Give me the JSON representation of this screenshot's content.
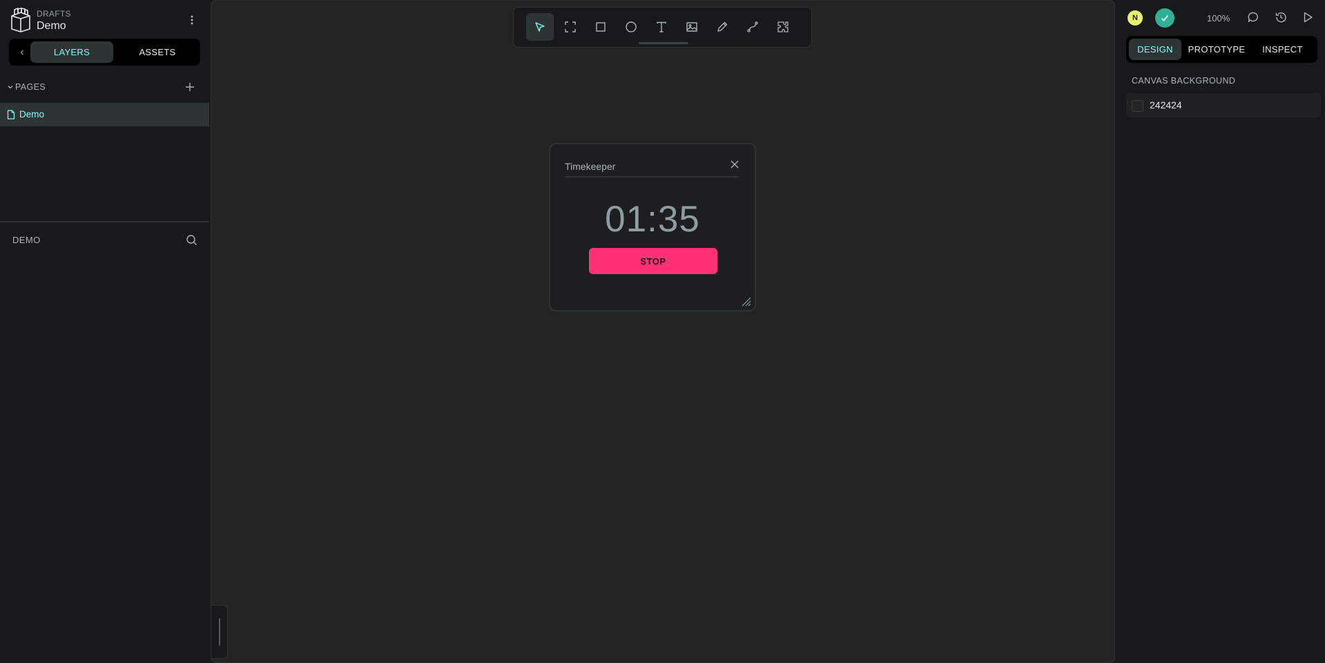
{
  "project": {
    "kind": "DRAFTS",
    "name": "Demo"
  },
  "left_tabs": {
    "layers": "LAYERS",
    "assets": "ASSETS"
  },
  "pages": {
    "title": "PAGES",
    "items": [
      {
        "label": "Demo",
        "selected": true
      }
    ]
  },
  "layers": {
    "title": "DEMO"
  },
  "toolbar": {
    "tools": [
      "move-icon",
      "board-icon",
      "rectangle-icon",
      "ellipse-icon",
      "text-icon",
      "image-icon",
      "pencil-icon",
      "path-icon",
      "plugins-icon"
    ],
    "active": "move-icon"
  },
  "dialog": {
    "title": "Timekeeper",
    "timer": "01:35",
    "button_label": "STOP",
    "button_color": "#ff3277"
  },
  "header": {
    "avatar_initial": "N",
    "zoom": "100%"
  },
  "right_tabs": {
    "design": "DESIGN",
    "prototype": "PROTOTYPE",
    "inspect": "INSPECT"
  },
  "canvas_background": {
    "title": "CANVAS BACKGROUND",
    "value": "242424"
  },
  "colors": {
    "accent": "#7efff5",
    "canvas": "#242424",
    "panel": "#18191b",
    "saved": "#31b095",
    "avatar": "#e7f36c"
  }
}
